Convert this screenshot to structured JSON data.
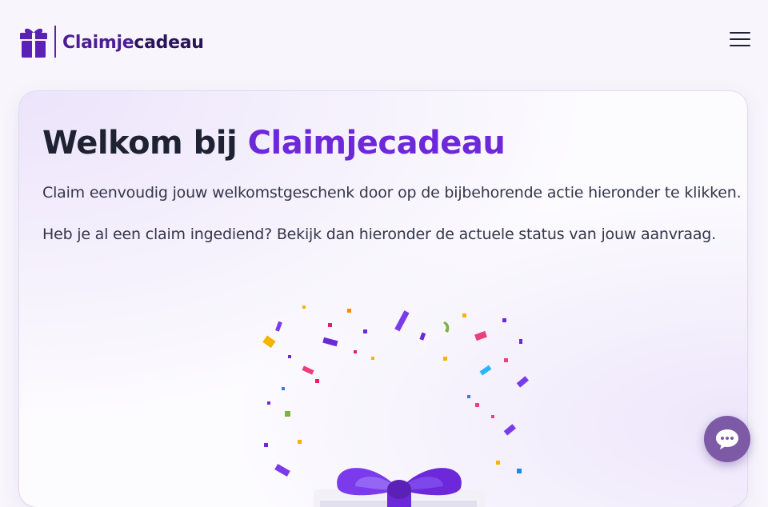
{
  "brand": {
    "name_part1": "Claimje",
    "name_part2": "cadeau"
  },
  "header": {
    "menu_icon": "hamburger-menu-icon"
  },
  "card": {
    "title_prefix": "Welkom bij ",
    "title_accent": "Claimjecadeau",
    "paragraph1": "Claim eenvoudig jouw welkomstgeschenk door op de bijbehorende actie hieronder te klikken.",
    "paragraph2": "Heb je al een claim ingediend? Bekijk dan hieronder de actuele status van jouw aanvraag."
  },
  "illustration": {
    "icon": "gift-confetti-icon"
  },
  "chat": {
    "icon": "chat-bubble-icon"
  },
  "colors": {
    "accent": "#6d28d9",
    "brand_dark": "#4c1d95",
    "chat_button": "#7c5aa6",
    "text": "#1f2233"
  }
}
